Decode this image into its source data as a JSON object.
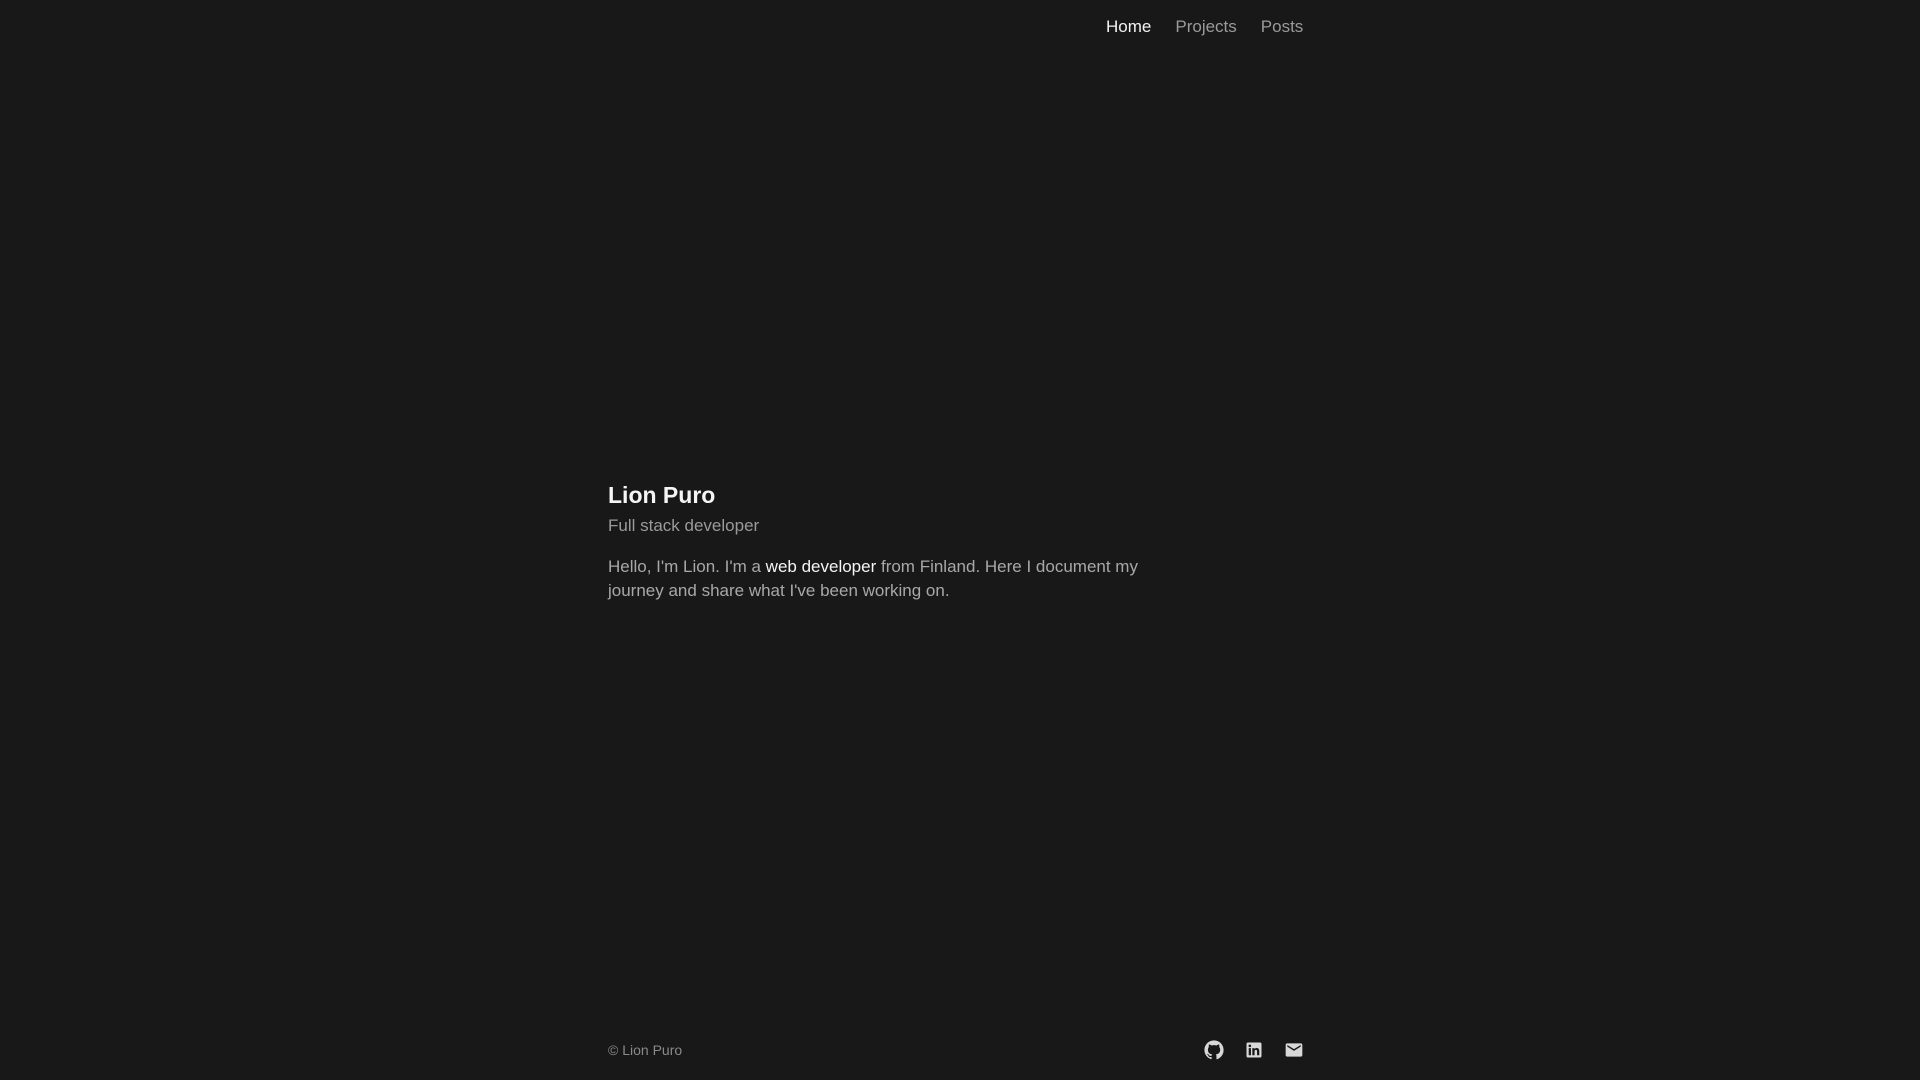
{
  "nav": {
    "items": [
      {
        "label": "Home",
        "active": true
      },
      {
        "label": "Projects",
        "active": false
      },
      {
        "label": "Posts",
        "active": false
      }
    ]
  },
  "hero": {
    "name": "Lion Puro",
    "subtitle": "Full stack developer",
    "bio_before": "Hello, I'm Lion. I'm a ",
    "bio_link": "web developer",
    "bio_after": " from Finland. Here I document my journey and share what I've been working on."
  },
  "footer": {
    "copyright": "© Lion Puro",
    "socials": [
      {
        "icon": "github-icon"
      },
      {
        "icon": "linkedin-icon"
      },
      {
        "icon": "mail-icon"
      }
    ]
  },
  "colors": {
    "background": "#181818",
    "text_primary": "#f5f5f5",
    "text_muted": "#9a9a9a"
  }
}
